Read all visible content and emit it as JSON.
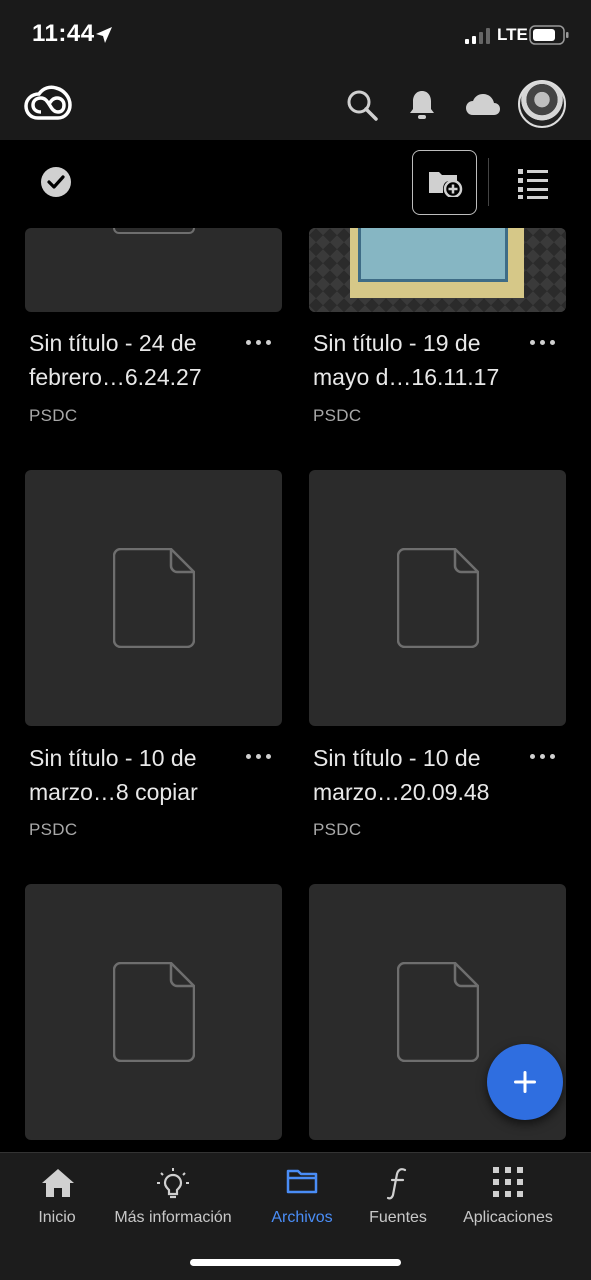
{
  "status_bar": {
    "time": "11:44",
    "network": "LTE",
    "icons": [
      "location-arrow-icon",
      "signal-icon",
      "battery-icon"
    ]
  },
  "header": {
    "icons": [
      "creative-cloud-logo",
      "search-icon",
      "bell-icon",
      "cloud-icon",
      "avatar"
    ]
  },
  "toolbar": {
    "icons": [
      "select-check-icon",
      "new-folder-icon",
      "list-view-icon"
    ]
  },
  "files": [
    {
      "title": "Sin título - 24 de febrero…6.24.27",
      "type": "PSDC"
    },
    {
      "title": "Sin título - 19 de mayo d…16.11.17",
      "type": "PSDC"
    },
    {
      "title": "Sin título - 10 de marzo…8 copiar",
      "type": "PSDC"
    },
    {
      "title": "Sin título - 10 de marzo…20.09.48",
      "type": "PSDC"
    },
    {
      "title": "",
      "type": ""
    },
    {
      "title": "",
      "type": ""
    }
  ],
  "fab": {
    "icon": "plus-icon"
  },
  "nav": {
    "items": [
      {
        "label": "Inicio",
        "icon": "home-icon",
        "active": false
      },
      {
        "label": "Más información",
        "icon": "lightbulb-icon",
        "active": false
      },
      {
        "label": "Archivos",
        "icon": "folder-icon",
        "active": true
      },
      {
        "label": "Fuentes",
        "icon": "font-f-icon",
        "active": false
      },
      {
        "label": "Aplicaciones",
        "icon": "grid-apps-icon",
        "active": false
      }
    ]
  },
  "colors": {
    "accent": "#2f6ee0",
    "active_nav": "#4a8df6",
    "card": "#2b2b2b",
    "background": "#000000"
  }
}
